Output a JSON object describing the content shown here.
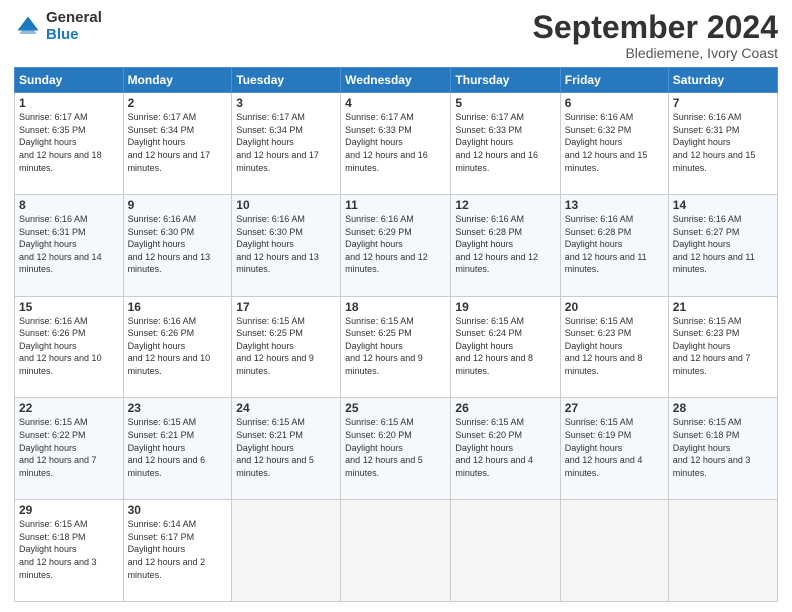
{
  "logo": {
    "general": "General",
    "blue": "Blue"
  },
  "title": "September 2024",
  "subtitle": "Blediemene, Ivory Coast",
  "days": [
    "Sunday",
    "Monday",
    "Tuesday",
    "Wednesday",
    "Thursday",
    "Friday",
    "Saturday"
  ],
  "weeks": [
    [
      {
        "day": "1",
        "sunrise": "6:17 AM",
        "sunset": "6:35 PM",
        "daylight": "12 hours and 18 minutes."
      },
      {
        "day": "2",
        "sunrise": "6:17 AM",
        "sunset": "6:34 PM",
        "daylight": "12 hours and 17 minutes."
      },
      {
        "day": "3",
        "sunrise": "6:17 AM",
        "sunset": "6:34 PM",
        "daylight": "12 hours and 17 minutes."
      },
      {
        "day": "4",
        "sunrise": "6:17 AM",
        "sunset": "6:33 PM",
        "daylight": "12 hours and 16 minutes."
      },
      {
        "day": "5",
        "sunrise": "6:17 AM",
        "sunset": "6:33 PM",
        "daylight": "12 hours and 16 minutes."
      },
      {
        "day": "6",
        "sunrise": "6:16 AM",
        "sunset": "6:32 PM",
        "daylight": "12 hours and 15 minutes."
      },
      {
        "day": "7",
        "sunrise": "6:16 AM",
        "sunset": "6:31 PM",
        "daylight": "12 hours and 15 minutes."
      }
    ],
    [
      {
        "day": "8",
        "sunrise": "6:16 AM",
        "sunset": "6:31 PM",
        "daylight": "12 hours and 14 minutes."
      },
      {
        "day": "9",
        "sunrise": "6:16 AM",
        "sunset": "6:30 PM",
        "daylight": "12 hours and 13 minutes."
      },
      {
        "day": "10",
        "sunrise": "6:16 AM",
        "sunset": "6:30 PM",
        "daylight": "12 hours and 13 minutes."
      },
      {
        "day": "11",
        "sunrise": "6:16 AM",
        "sunset": "6:29 PM",
        "daylight": "12 hours and 12 minutes."
      },
      {
        "day": "12",
        "sunrise": "6:16 AM",
        "sunset": "6:28 PM",
        "daylight": "12 hours and 12 minutes."
      },
      {
        "day": "13",
        "sunrise": "6:16 AM",
        "sunset": "6:28 PM",
        "daylight": "12 hours and 11 minutes."
      },
      {
        "day": "14",
        "sunrise": "6:16 AM",
        "sunset": "6:27 PM",
        "daylight": "12 hours and 11 minutes."
      }
    ],
    [
      {
        "day": "15",
        "sunrise": "6:16 AM",
        "sunset": "6:26 PM",
        "daylight": "12 hours and 10 minutes."
      },
      {
        "day": "16",
        "sunrise": "6:16 AM",
        "sunset": "6:26 PM",
        "daylight": "12 hours and 10 minutes."
      },
      {
        "day": "17",
        "sunrise": "6:15 AM",
        "sunset": "6:25 PM",
        "daylight": "12 hours and 9 minutes."
      },
      {
        "day": "18",
        "sunrise": "6:15 AM",
        "sunset": "6:25 PM",
        "daylight": "12 hours and 9 minutes."
      },
      {
        "day": "19",
        "sunrise": "6:15 AM",
        "sunset": "6:24 PM",
        "daylight": "12 hours and 8 minutes."
      },
      {
        "day": "20",
        "sunrise": "6:15 AM",
        "sunset": "6:23 PM",
        "daylight": "12 hours and 8 minutes."
      },
      {
        "day": "21",
        "sunrise": "6:15 AM",
        "sunset": "6:23 PM",
        "daylight": "12 hours and 7 minutes."
      }
    ],
    [
      {
        "day": "22",
        "sunrise": "6:15 AM",
        "sunset": "6:22 PM",
        "daylight": "12 hours and 7 minutes."
      },
      {
        "day": "23",
        "sunrise": "6:15 AM",
        "sunset": "6:21 PM",
        "daylight": "12 hours and 6 minutes."
      },
      {
        "day": "24",
        "sunrise": "6:15 AM",
        "sunset": "6:21 PM",
        "daylight": "12 hours and 5 minutes."
      },
      {
        "day": "25",
        "sunrise": "6:15 AM",
        "sunset": "6:20 PM",
        "daylight": "12 hours and 5 minutes."
      },
      {
        "day": "26",
        "sunrise": "6:15 AM",
        "sunset": "6:20 PM",
        "daylight": "12 hours and 4 minutes."
      },
      {
        "day": "27",
        "sunrise": "6:15 AM",
        "sunset": "6:19 PM",
        "daylight": "12 hours and 4 minutes."
      },
      {
        "day": "28",
        "sunrise": "6:15 AM",
        "sunset": "6:18 PM",
        "daylight": "12 hours and 3 minutes."
      }
    ],
    [
      {
        "day": "29",
        "sunrise": "6:15 AM",
        "sunset": "6:18 PM",
        "daylight": "12 hours and 3 minutes."
      },
      {
        "day": "30",
        "sunrise": "6:14 AM",
        "sunset": "6:17 PM",
        "daylight": "12 hours and 2 minutes."
      },
      null,
      null,
      null,
      null,
      null
    ]
  ]
}
